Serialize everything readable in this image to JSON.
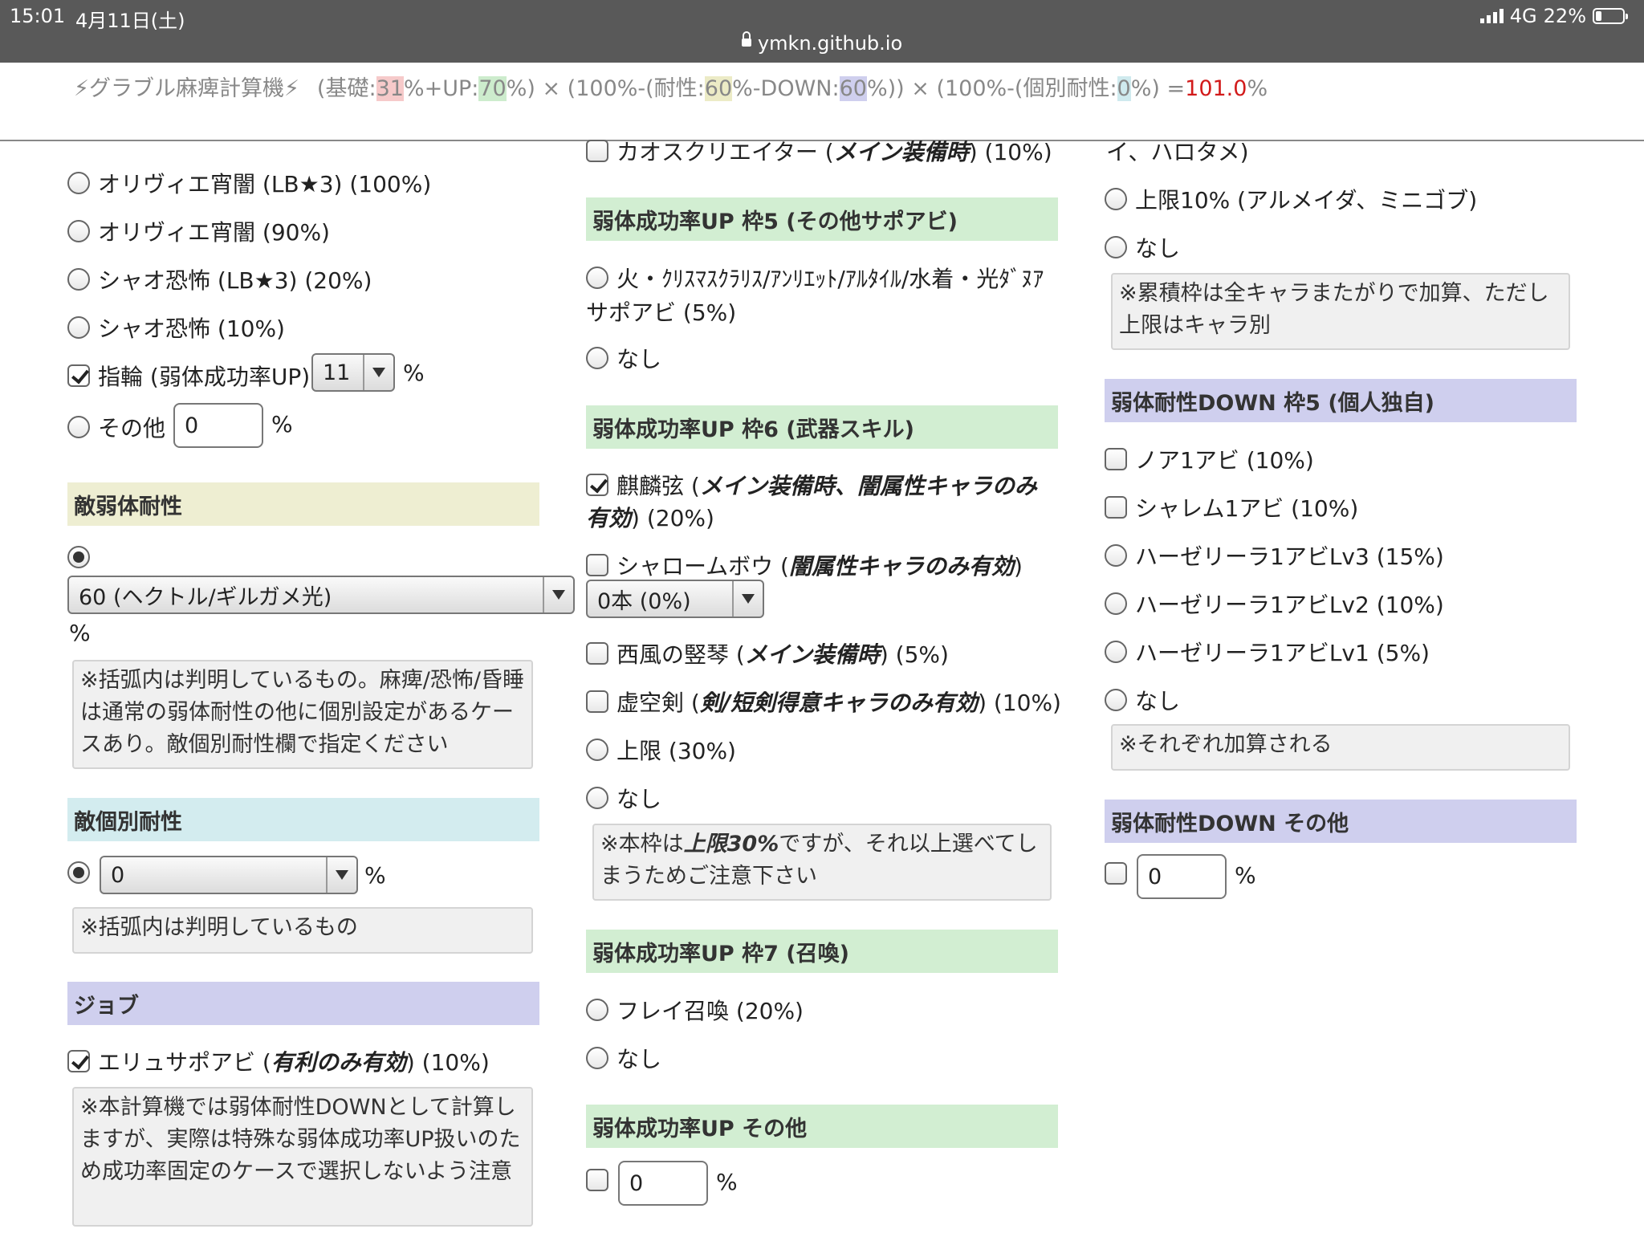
{
  "status_bar": {
    "time": "15:01",
    "date": "4月11日(土)",
    "network": "4G",
    "battery": "22%",
    "battery_level": 0.22
  },
  "url": "ymkn.github.io",
  "formula": {
    "title": "⚡グラブル麻痺計算機⚡",
    "p1": "(基礎:",
    "base": "31",
    "p2": "%+UP:",
    "up": "70",
    "p3": "%) × (100%-(耐性:",
    "resist": "60",
    "p4": "%-DOWN:",
    "down": "60",
    "p5": "%)) × (100%-(個別耐性:",
    "individual": "0",
    "p6": "%) =",
    "result": "101.0",
    "p7": "%"
  },
  "col1": {
    "opt_olivier_lb": "オリヴィエ宵闇 (LB★3) (100%)",
    "opt_olivier": "オリヴィエ宵闇 (90%)",
    "opt_shao_lb": "シャオ恐怖 (LB★3) (20%)",
    "opt_shao": "シャオ恐怖 (10%)",
    "ring_label": "指輪 (弱体成功率UP)",
    "ring_value": "11",
    "ring_unit": "%",
    "other_label": "その他",
    "other_value": "0",
    "other_unit": "%",
    "enemy_resist_header": "敵弱体耐性",
    "enemy_resist_value": "60 (ヘクトル/ギルガメ光)",
    "enemy_resist_unit": "%",
    "enemy_resist_note": "※括弧内は判明しているもの。麻痺/恐怖/昏睡は通常の弱体耐性の他に個別設定があるケースあり。敵個別耐性欄で指定ください",
    "individual_header": "敵個別耐性",
    "individual_value": "0",
    "individual_unit": "%",
    "individual_note": "※括弧内は判明しているもの",
    "job_header": "ジョブ",
    "job_opt_pre": "エリュサポアビ (",
    "job_opt_em": "有利のみ有効",
    "job_opt_post": ") (10%)",
    "job_note": "※本計算機では弱体耐性DOWNとして計算しますが、実際は特殊な弱体成功率UP扱いのため成功率固定のケースで選択しないよう注意"
  },
  "col2": {
    "top_pre": "カオスクリエイター (",
    "top_em": "メイン装備時",
    "top_post": ") (10%)",
    "frame5_header": "弱体成功率UP 枠5 (その他サポアビ)",
    "frame5_opt": "火・ｸﾘｽﾏｽｸﾗﾘｽ/ｱﾝﾘｴｯﾄ/ｱﾙﾀｲﾙ/水着・光ﾀﾞﾇｱ",
    "frame5_opt2": "サポアビ (5%)",
    "frame5_none": "なし",
    "frame6_header": "弱体成功率UP 枠6 (武器スキル)",
    "kirin_pre": "麒麟弦 (",
    "kirin_em": "メイン装備時、闇属性キャラのみ",
    "kirin_em2": "有効",
    "kirin_post": ") (20%)",
    "charlotte_pre": "シャロームボウ (",
    "charlotte_em": "闇属性キャラのみ有効",
    "charlotte_post": ")",
    "charlotte_select": "0本 (0%)",
    "nishikaze_pre": "西風の竪琴 (",
    "nishikaze_em": "メイン装備時",
    "nishikaze_post": ") (5%)",
    "kokuu_pre": "虚空剣 (",
    "kokuu_em": "剣/短剣得意キャラのみ有効",
    "kokuu_post": ") (10%)",
    "frame6_cap": "上限 (30%)",
    "frame6_none": "なし",
    "frame6_note_pre": "※本枠は",
    "frame6_note_em": "上限30%",
    "frame6_note_post": "ですが、それ以上選べてし",
    "frame6_note_line2": "まうためご注意下さい",
    "frame7_header": "弱体成功率UP 枠7 (召喚)",
    "frame7_opt": "フレイ召喚 (20%)",
    "frame7_none": "なし",
    "other_header": "弱体成功率UP その他",
    "other_value": "0",
    "other_unit": "%"
  },
  "col3": {
    "top_text": "イ、ハロタメ)",
    "cap10": "上限10% (アルメイダ、ミニゴブ)",
    "none1": "なし",
    "note1": "※累積枠は全キャラまたがりで加算、ただし上限はキャラ別",
    "down5_header": "弱体耐性DOWN 枠5 (個人独自)",
    "noa": "ノア1アビ (10%)",
    "sharem": "シャレム1アビ (10%)",
    "hz3": "ハーゼリーラ1アビLv3 (15%)",
    "hz2": "ハーゼリーラ1アビLv2 (10%)",
    "hz1": "ハーゼリーラ1アビLv1 (5%)",
    "none2": "なし",
    "note2": "※それぞれ加算される",
    "down_other_header": "弱体耐性DOWN その他",
    "down_other_value": "0",
    "down_other_unit": "%"
  }
}
